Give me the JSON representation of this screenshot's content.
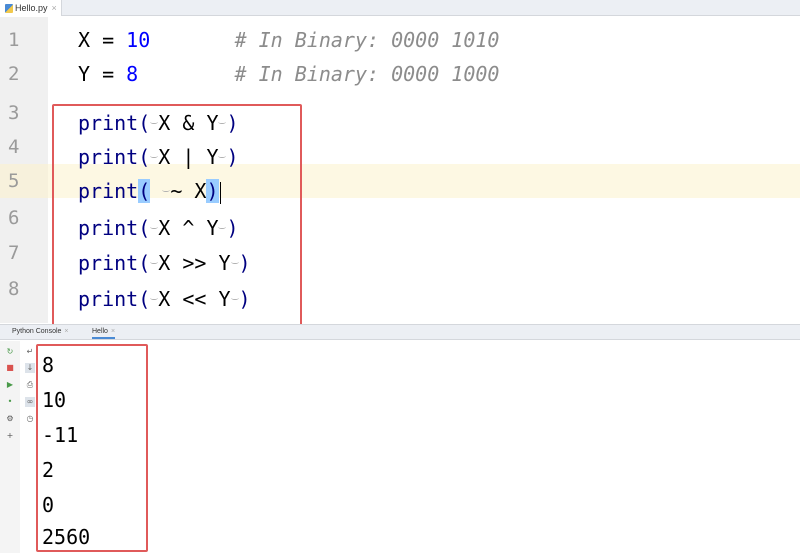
{
  "editor_tab": {
    "label": "Hello.py",
    "close": "×"
  },
  "gutter": [
    "1",
    "2",
    "3",
    "4",
    "5",
    "6",
    "7",
    "8"
  ],
  "code": {
    "l1": {
      "name": "X",
      "eq": " = ",
      "val": "10",
      "pad": "       ",
      "comment": "# In Binary: 0000 1010"
    },
    "l2": {
      "name": "Y",
      "eq": " = ",
      "val": "8",
      "pad": "        ",
      "comment": "# In Binary: 0000 1000"
    },
    "print": "print(",
    "l3": {
      "a": "X",
      "op": "&",
      "b": "Y",
      "close": ")"
    },
    "l4": {
      "a": "X",
      "op": "|",
      "b": "Y",
      "close": ")"
    },
    "l5": {
      "op": "~",
      "a": "X",
      "close": ")"
    },
    "l6": {
      "a": "X",
      "op": "^",
      "b": "Y",
      "close": ")"
    },
    "l7": {
      "a": "X",
      "op": ">>",
      "b": "Y",
      "close": ")"
    },
    "l8": {
      "a": "X",
      "op": "<<",
      "b": "Y",
      "close": ")"
    }
  },
  "console_tabs": [
    {
      "label": "Python Console",
      "close": "×"
    },
    {
      "label": "Hello",
      "close": "×"
    }
  ],
  "output": [
    "8",
    "10",
    "-11",
    "2",
    "0",
    "2560"
  ],
  "colors": {
    "highlight_box": "#e05a5a",
    "keyword": "#000080",
    "number": "#0000ff",
    "comment": "#8c8c8c"
  },
  "icons": [
    "rerun-icon",
    "stop-icon",
    "run-icon",
    "debug-icon",
    "settings-icon",
    "add-icon",
    "soft-wrap-icon",
    "scroll-to-end-icon",
    "print-icon",
    "clear-icon",
    "history-icon"
  ]
}
